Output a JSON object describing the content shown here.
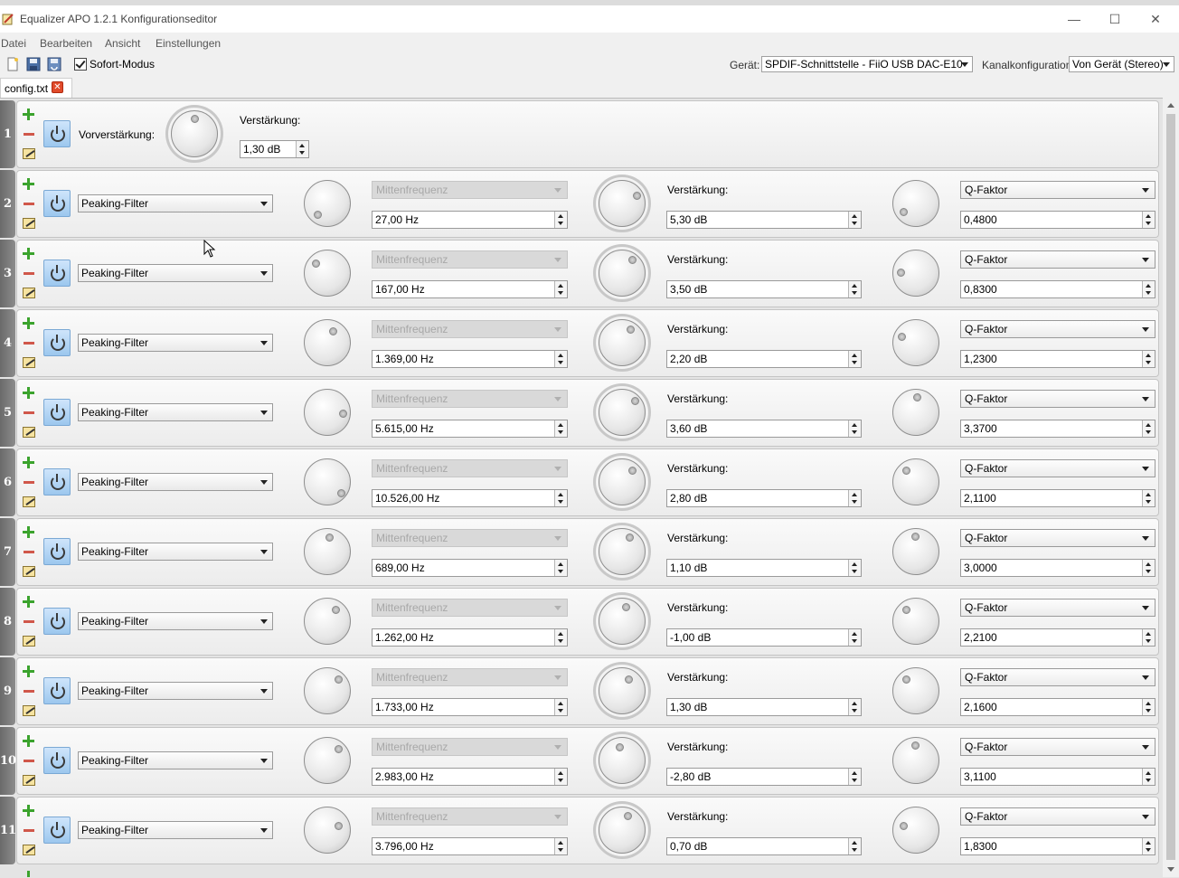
{
  "window": {
    "title": "Equalizer APO 1.2.1 Konfigurationseditor"
  },
  "menu": [
    "Datei",
    "Bearbeiten",
    "Ansicht",
    "Einstellungen"
  ],
  "toolbar": {
    "instant_mode_label": "Sofort-Modus",
    "device_label": "Gerät:",
    "device_value": "SPDIF-Schnittstelle - FiiO USB DAC-E10",
    "channel_label": "Kanalkonfiguration:",
    "channel_value": "Von Gerät (Stereo)"
  },
  "tab": {
    "label": "config.txt"
  },
  "preamp": {
    "number": "1",
    "label": "Vorverstärkung:",
    "gain_label": "Verstärkung:",
    "gain_value": "1,30 dB"
  },
  "filters": [
    {
      "number": "2",
      "type": "Peaking-Filter",
      "freq_label": "Mittenfrequenz",
      "freq": "27,00 Hz",
      "gain_label": "Verstärkung:",
      "gain": "5,30 dB",
      "q_label": "Q-Faktor",
      "q": "0,4800"
    },
    {
      "number": "3",
      "type": "Peaking-Filter",
      "freq_label": "Mittenfrequenz",
      "freq": "167,00 Hz",
      "gain_label": "Verstärkung:",
      "gain": "3,50 dB",
      "q_label": "Q-Faktor",
      "q": "0,8300"
    },
    {
      "number": "4",
      "type": "Peaking-Filter",
      "freq_label": "Mittenfrequenz",
      "freq": "1.369,00 Hz",
      "gain_label": "Verstärkung:",
      "gain": "2,20 dB",
      "q_label": "Q-Faktor",
      "q": "1,2300"
    },
    {
      "number": "5",
      "type": "Peaking-Filter",
      "freq_label": "Mittenfrequenz",
      "freq": "5.615,00 Hz",
      "gain_label": "Verstärkung:",
      "gain": "3,60 dB",
      "q_label": "Q-Faktor",
      "q": "3,3700"
    },
    {
      "number": "6",
      "type": "Peaking-Filter",
      "freq_label": "Mittenfrequenz",
      "freq": "10.526,00 Hz",
      "gain_label": "Verstärkung:",
      "gain": "2,80 dB",
      "q_label": "Q-Faktor",
      "q": "2,1100"
    },
    {
      "number": "7",
      "type": "Peaking-Filter",
      "freq_label": "Mittenfrequenz",
      "freq": "689,00 Hz",
      "gain_label": "Verstärkung:",
      "gain": "1,10 dB",
      "q_label": "Q-Faktor",
      "q": "3,0000"
    },
    {
      "number": "8",
      "type": "Peaking-Filter",
      "freq_label": "Mittenfrequenz",
      "freq": "1.262,00 Hz",
      "gain_label": "Verstärkung:",
      "gain": "-1,00 dB",
      "q_label": "Q-Faktor",
      "q": "2,2100"
    },
    {
      "number": "9",
      "type": "Peaking-Filter",
      "freq_label": "Mittenfrequenz",
      "freq": "1.733,00 Hz",
      "gain_label": "Verstärkung:",
      "gain": "1,30 dB",
      "q_label": "Q-Faktor",
      "q": "2,1600"
    },
    {
      "number": "10",
      "type": "Peaking-Filter",
      "freq_label": "Mittenfrequenz",
      "freq": "2.983,00 Hz",
      "gain_label": "Verstärkung:",
      "gain": "-2,80 dB",
      "q_label": "Q-Faktor",
      "q": "3,1100"
    },
    {
      "number": "11",
      "type": "Peaking-Filter",
      "freq_label": "Mittenfrequenz",
      "freq": "3.796,00 Hz",
      "gain_label": "Verstärkung:",
      "gain": "0,70 dB",
      "q_label": "Q-Faktor",
      "q": "1,8300"
    }
  ]
}
